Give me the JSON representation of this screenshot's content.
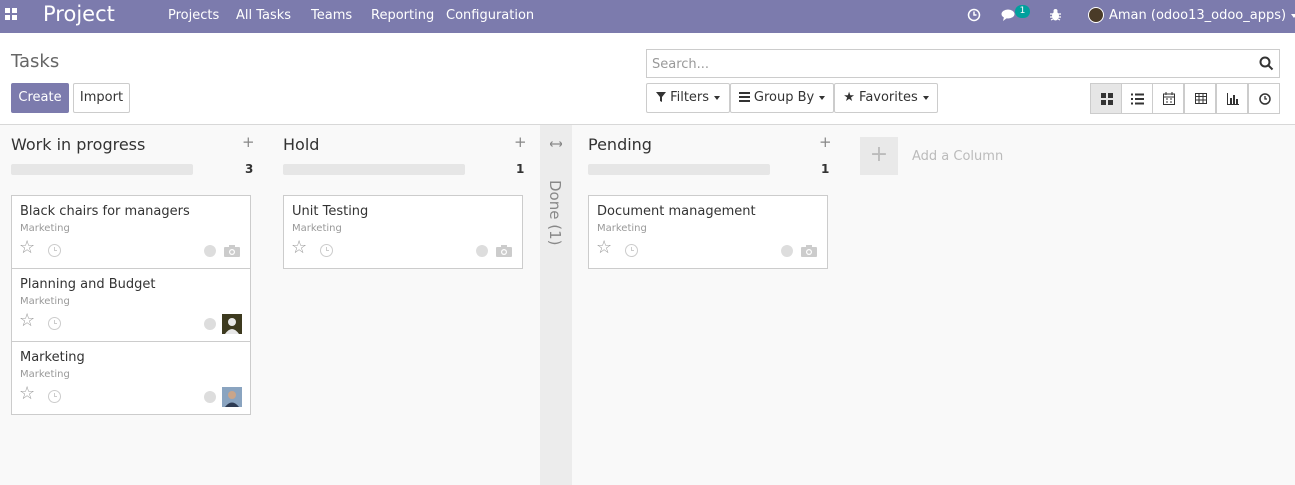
{
  "navbar": {
    "brand": "Project",
    "menu": [
      "Projects",
      "All Tasks",
      "Teams",
      "Reporting",
      "Configuration"
    ],
    "messages_badge": "1",
    "user": "Aman (odoo13_odoo_apps)"
  },
  "control_panel": {
    "title": "Tasks",
    "create_label": "Create",
    "import_label": "Import",
    "search_placeholder": "Search...",
    "filters_label": "Filters",
    "groupby_label": "Group By",
    "favorites_label": "Favorites",
    "views": [
      "kanban",
      "list",
      "calendar",
      "pivot",
      "graph",
      "activity"
    ],
    "active_view": "kanban"
  },
  "columns": [
    {
      "title": "Work in progress",
      "count": "3",
      "cards": [
        {
          "title": "Black chairs for managers",
          "tag": "Marketing",
          "assignee": "camera-icon"
        },
        {
          "title": "Planning and Budget",
          "tag": "Marketing",
          "assignee": "avatar"
        },
        {
          "title": "Marketing",
          "tag": "Marketing",
          "assignee": "avatar"
        }
      ]
    },
    {
      "title": "Hold",
      "count": "1",
      "cards": [
        {
          "title": "Unit Testing",
          "tag": "Marketing",
          "assignee": "camera-icon"
        }
      ]
    },
    {
      "title": "Pending",
      "count": "1",
      "cards": [
        {
          "title": "Document management",
          "tag": "Marketing",
          "assignee": "camera-icon"
        }
      ]
    }
  ],
  "folded_column": {
    "label": "Done (1)"
  },
  "add_column": {
    "plus": "+",
    "label": "Add a Column"
  },
  "colors": {
    "navbar": "#7c7bad",
    "badge": "#00a09d",
    "primary": "#7c7bad"
  }
}
